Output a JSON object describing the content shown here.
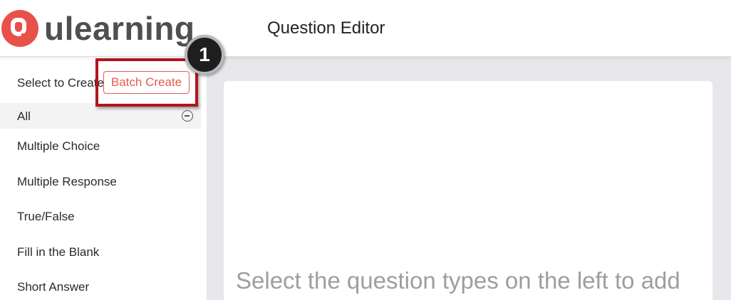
{
  "header": {
    "logo_text": "ulearning",
    "title": "Question Editor"
  },
  "sidebar": {
    "select_label": "Select to Create",
    "batch_create_label": "Batch Create",
    "all_label": "All",
    "question_types": [
      "Multiple Choice",
      "Multiple Response",
      "True/False",
      "Fill in the Blank",
      "Short Answer"
    ]
  },
  "main": {
    "placeholder": "Select the question types on the left to add"
  },
  "annotation": {
    "step_number": "1"
  },
  "colors": {
    "brand": "#e8514a",
    "accent": "#e85a50",
    "highlight": "#b3141c"
  },
  "icons": {
    "logo": "ulearning-logo-icon",
    "collapse": "minus-circle-icon"
  }
}
